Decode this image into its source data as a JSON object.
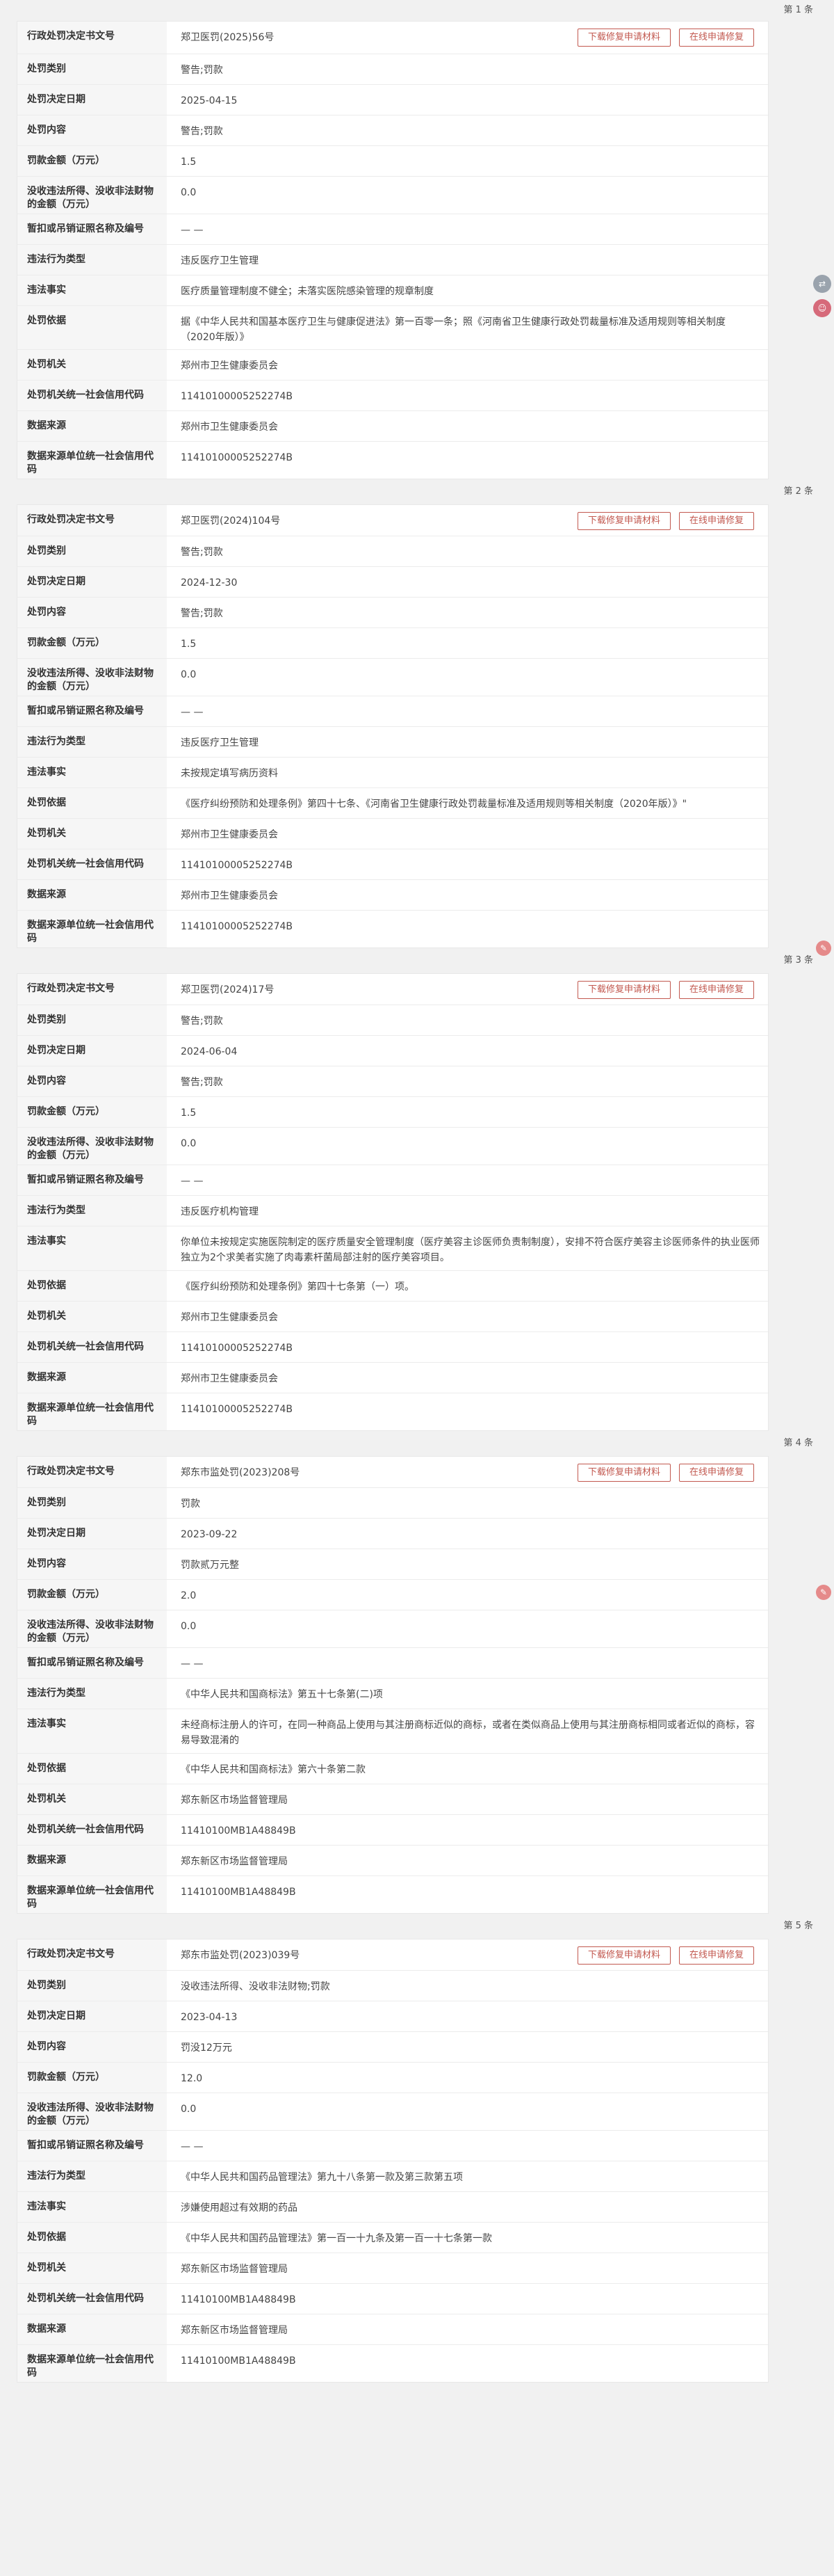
{
  "labels": {
    "doc_no": "行政处罚决定书文号",
    "category": "处罚类别",
    "date": "处罚决定日期",
    "content": "处罚内容",
    "fine": "罚款金额（万元）",
    "confiscation": "没收违法所得、没收非法财物的金额（万元）",
    "license": "暂扣或吊销证照名称及编号",
    "violation_type": "违法行为类型",
    "facts": "违法事实",
    "basis": "处罚依据",
    "authority": "处罚机关",
    "authority_code": "处罚机关统一社会信用代码",
    "source": "数据来源",
    "source_code": "数据来源单位统一社会信用代码"
  },
  "buttons": {
    "download": "下载修复申请材料",
    "repair": "在线申请修复"
  },
  "side_icons": [
    {
      "icon": "share-icon",
      "color": "#9aa3ad"
    },
    {
      "icon": "service-icon",
      "color": "#d66a7a"
    },
    {
      "icon": "feedback-icon",
      "color": "#e58a8a"
    },
    {
      "icon": "feedback-icon",
      "color": "#e58a8a"
    }
  ],
  "records": [
    {
      "index": "第 1 条",
      "doc_no": "郑卫医罚(2025)56号",
      "category": "警告;罚款",
      "date": "2025-04-15",
      "content": "警告;罚款",
      "fine": "1.5",
      "confiscation": "0.0",
      "license": "— —",
      "violation_type": "违反医疗卫生管理",
      "facts": "医疗质量管理制度不健全；未落实医院感染管理的规章制度",
      "basis": "据《中华人民共和国基本医疗卫生与健康促进法》第一百零一条；照《河南省卫生健康行政处罚裁量标准及适用规则等相关制度（2020年版）》",
      "authority": "郑州市卫生健康委员会",
      "authority_code": "11410100005252274B",
      "source": "郑州市卫生健康委员会",
      "source_code": "11410100005252274B"
    },
    {
      "index": "第 2 条",
      "doc_no": "郑卫医罚(2024)104号",
      "category": "警告;罚款",
      "date": "2024-12-30",
      "content": "警告;罚款",
      "fine": "1.5",
      "confiscation": "0.0",
      "license": "— —",
      "violation_type": "违反医疗卫生管理",
      "facts": "未按规定填写病历资料",
      "basis": "《医疗纠纷预防和处理条例》第四十七条、《河南省卫生健康行政处罚裁量标准及适用规则等相关制度（2020年版）》\"",
      "authority": "郑州市卫生健康委员会",
      "authority_code": "11410100005252274B",
      "source": "郑州市卫生健康委员会",
      "source_code": "11410100005252274B"
    },
    {
      "index": "第 3 条",
      "doc_no": "郑卫医罚(2024)17号",
      "category": "警告;罚款",
      "date": "2024-06-04",
      "content": "警告;罚款",
      "fine": "1.5",
      "confiscation": "0.0",
      "license": "— —",
      "violation_type": "违反医疗机构管理",
      "facts": "你单位未按规定实施医院制定的医疗质量安全管理制度（医疗美容主诊医师负责制制度），安排不符合医疗美容主诊医师条件的执业医师独立为2个求美者实施了肉毒素杆菌局部注射的医疗美容项目。",
      "basis": "《医疗纠纷预防和处理条例》第四十七条第（一）项。",
      "authority": "郑州市卫生健康委员会",
      "authority_code": "11410100005252274B",
      "source": "郑州市卫生健康委员会",
      "source_code": "11410100005252274B"
    },
    {
      "index": "第 4 条",
      "doc_no": "郑东市监处罚(2023)208号",
      "category": "罚款",
      "date": "2023-09-22",
      "content": "罚款贰万元整",
      "fine": "2.0",
      "confiscation": "0.0",
      "license": "— —",
      "violation_type": "《中华人民共和国商标法》第五十七条第(二)项",
      "facts": "未经商标注册人的许可，在同一种商品上使用与其注册商标近似的商标，或者在类似商品上使用与其注册商标相同或者近似的商标，容易导致混淆的",
      "basis": "《中华人民共和国商标法》第六十条第二款",
      "authority": "郑东新区市场监督管理局",
      "authority_code": "11410100MB1A48849B",
      "source": "郑东新区市场监督管理局",
      "source_code": "11410100MB1A48849B"
    },
    {
      "index": "第 5 条",
      "doc_no": "郑东市监处罚(2023)039号",
      "category": "没收违法所得、没收非法财物;罚款",
      "date": "2023-04-13",
      "content": "罚没12万元",
      "fine": "12.0",
      "confiscation": "0.0",
      "license": "— —",
      "violation_type": "《中华人民共和国药品管理法》第九十八条第一款及第三款第五项",
      "facts": "涉嫌使用超过有效期的药品",
      "basis": "《中华人民共和国药品管理法》第一百一十九条及第一百一十七条第一款",
      "authority": "郑东新区市场监督管理局",
      "authority_code": "11410100MB1A48849B",
      "source": "郑东新区市场监督管理局",
      "source_code": "11410100MB1A48849B"
    }
  ]
}
